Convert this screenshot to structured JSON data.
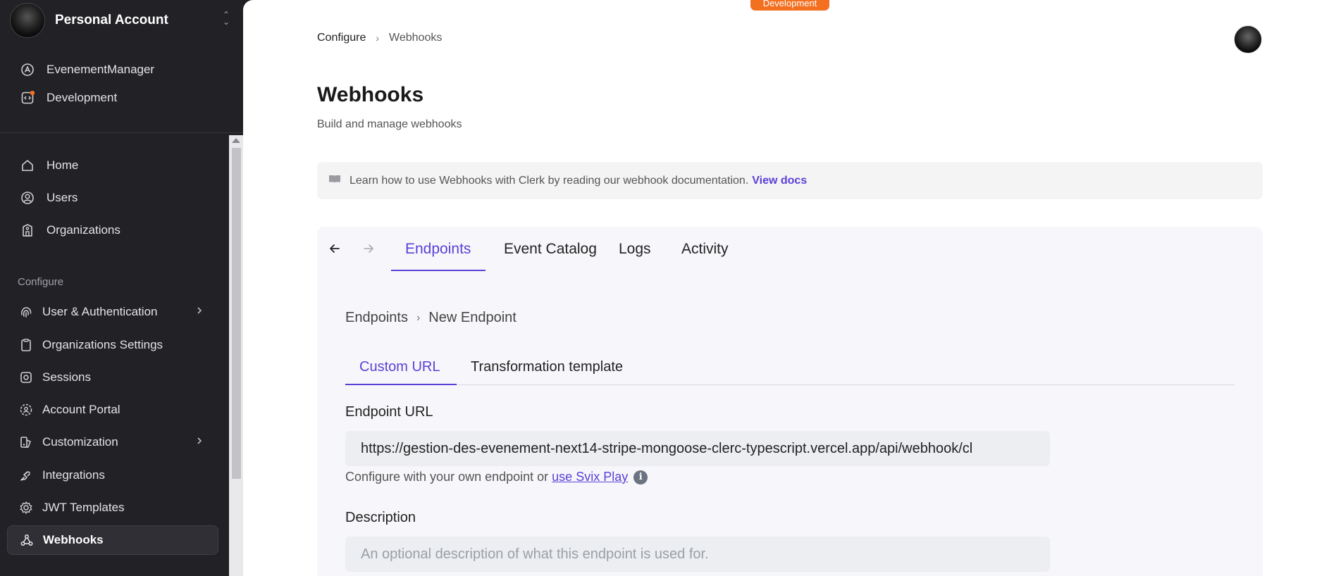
{
  "sidebar": {
    "account_name": "Personal Account",
    "apps": [
      {
        "label": "EvenementManager",
        "icon": "app-icon"
      },
      {
        "label": "Development",
        "icon": "dev-instance-icon"
      }
    ],
    "nav_primary": [
      {
        "label": "Home",
        "icon": "home-icon"
      },
      {
        "label": "Users",
        "icon": "user-icon"
      },
      {
        "label": "Organizations",
        "icon": "building-icon"
      }
    ],
    "section_label": "Configure",
    "nav_configure": [
      {
        "label": "User & Authentication",
        "icon": "fingerprint-icon"
      },
      {
        "label": "Organizations Settings",
        "icon": "clipboard-icon"
      },
      {
        "label": "Sessions",
        "icon": "sessions-icon"
      },
      {
        "label": "Account Portal",
        "icon": "portal-icon"
      },
      {
        "label": "Customization",
        "icon": "palette-icon"
      },
      {
        "label": "Integrations",
        "icon": "plug-icon"
      },
      {
        "label": "JWT Templates",
        "icon": "gear-icon"
      },
      {
        "label": "Webhooks",
        "icon": "webhook-icon"
      }
    ]
  },
  "header": {
    "env_badge": "Development",
    "breadcrumb": [
      "Configure",
      "Webhooks"
    ]
  },
  "page": {
    "title": "Webhooks",
    "subtitle": "Build and manage webhooks",
    "info_text": "Learn how to use Webhooks with Clerk by reading our webhook documentation.",
    "info_link": "View docs"
  },
  "portal": {
    "tabs": [
      "Endpoints",
      "Event Catalog",
      "Logs",
      "Activity"
    ],
    "breadcrumb": [
      "Endpoints",
      "New Endpoint"
    ],
    "subtabs": [
      "Custom URL",
      "Transformation template"
    ],
    "endpoint_url_label": "Endpoint URL",
    "endpoint_url_value": "https://gestion-des-evenement-next14-stripe-mongoose-clerc-typescript.vercel.app/api/webhook/cl",
    "hint_text": "Configure with your own endpoint or",
    "hint_link": "use Svix Play",
    "description_label": "Description",
    "description_placeholder": "An optional description of what this endpoint is used for."
  },
  "colors": {
    "accent": "#5b3fd6",
    "badge": "#f37021",
    "sidebar_bg": "#212126"
  }
}
